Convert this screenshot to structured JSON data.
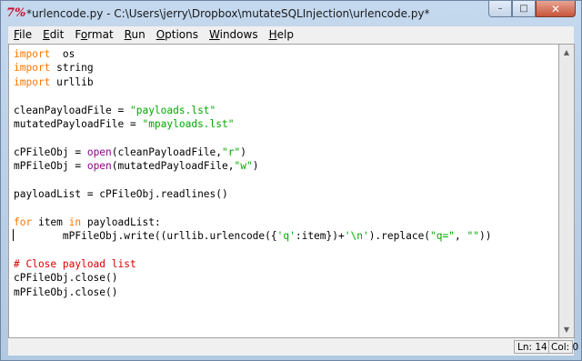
{
  "window": {
    "title": "*urlencode.py - C:\\Users\\jerry\\Dropbox\\mutateSQLInjection\\urlencode.py*",
    "icon_glyph": "7%",
    "buttons": {
      "minimize": "–",
      "maximize": "□",
      "close": "✕"
    }
  },
  "menu": {
    "items": [
      {
        "u": "F",
        "rest": "ile"
      },
      {
        "u": "E",
        "rest": "dit"
      },
      {
        "u": "",
        "pre": "F",
        "u2": "o",
        "rest": "rmat"
      },
      {
        "u": "R",
        "rest": "un"
      },
      {
        "u": "O",
        "rest": "ptions"
      },
      {
        "u": "W",
        "rest": "indows"
      },
      {
        "u": "H",
        "rest": "elp"
      }
    ]
  },
  "code": {
    "lines": [
      [
        [
          "kw",
          "import"
        ],
        [
          "",
          "  os"
        ]
      ],
      [
        [
          "kw",
          "import"
        ],
        [
          "",
          " string"
        ]
      ],
      [
        [
          "kw",
          "import"
        ],
        [
          "",
          " urllib"
        ]
      ],
      [],
      [
        [
          "",
          "cleanPayloadFile = "
        ],
        [
          "str",
          "\"payloads.lst\""
        ]
      ],
      [
        [
          "",
          "mutatedPayloadFile = "
        ],
        [
          "str",
          "\"mpayloads.lst\""
        ]
      ],
      [],
      [
        [
          "",
          "cPFileObj = "
        ],
        [
          "bi",
          "open"
        ],
        [
          "",
          "(cleanPayloadFile,"
        ],
        [
          "str",
          "\"r\""
        ],
        [
          "",
          ")"
        ]
      ],
      [
        [
          "",
          "mPFileObj = "
        ],
        [
          "bi",
          "open"
        ],
        [
          "",
          "(mutatedPayloadFile,"
        ],
        [
          "str",
          "\"w\""
        ],
        [
          "",
          ")"
        ]
      ],
      [],
      [
        [
          "",
          "payloadList = cPFileObj.readlines()"
        ]
      ],
      [],
      [
        [
          "kw",
          "for"
        ],
        [
          "",
          " item "
        ],
        [
          "kw",
          "in"
        ],
        [
          "",
          " payloadList:"
        ]
      ],
      [
        [
          "",
          "        mPFileObj.write((urllib.urlencode({"
        ],
        [
          "str",
          "'q'"
        ],
        [
          "",
          ":item})+"
        ],
        [
          "str",
          "'\\n'"
        ],
        [
          "",
          ").replace("
        ],
        [
          "str",
          "\"q=\""
        ],
        [
          "",
          ", "
        ],
        [
          "str",
          "\"\""
        ],
        [
          "",
          "))"
        ]
      ],
      [],
      [
        [
          "cm",
          "# Close payload list"
        ]
      ],
      [
        [
          "",
          "cPFileObj.close()"
        ]
      ],
      [
        [
          "",
          "mPFileObj.close()"
        ]
      ]
    ]
  },
  "status": {
    "line": "Ln: 14",
    "col": "Col: 0"
  }
}
